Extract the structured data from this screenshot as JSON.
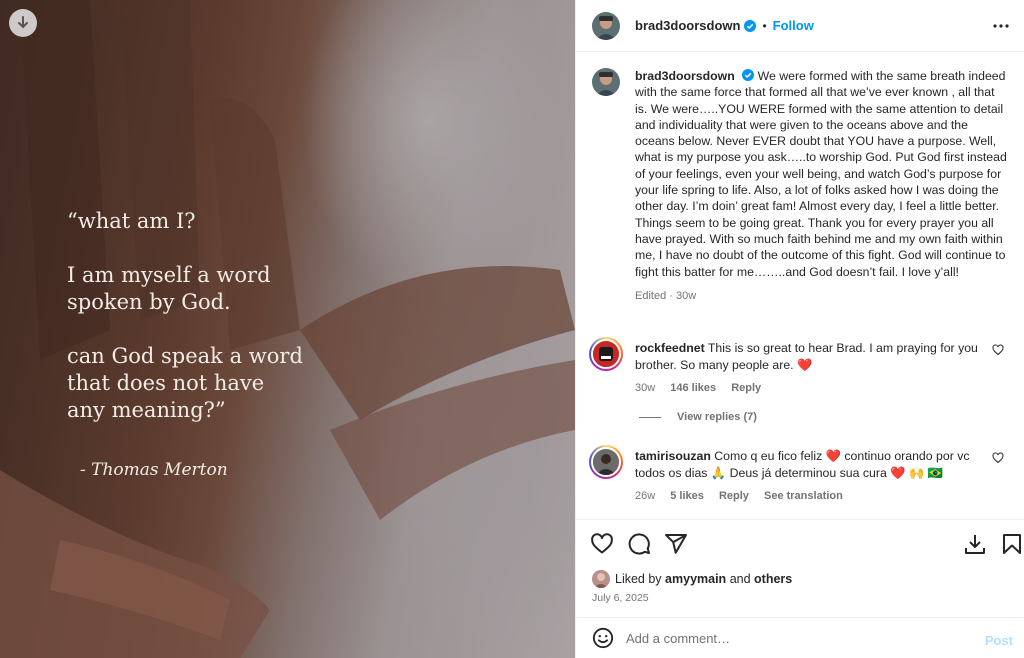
{
  "media": {
    "quote_lines": [
      "“what am I?",
      "I am myself a word\nspoken by God.",
      "can God speak a word\nthat does not have\nany meaning?”"
    ],
    "author": "- Thomas Merton",
    "download_icon": "download-arrow-icon"
  },
  "header": {
    "username": "brad3doorsdown",
    "dot": "•",
    "follow_label": "Follow",
    "verified_icon": "verified-badge-icon",
    "more_icon": "more-options-icon"
  },
  "caption": {
    "username": "brad3doorsdown",
    "text": "We were formed with the same breath indeed with the same force that formed all that we’ve ever known , all that is. We were…..YOU WERE formed with the same attention to detail and individuality that were given to the oceans above and the oceans below. Never EVER doubt that YOU have a purpose. Well, what is my purpose you ask…..to worship God. Put God first instead of your feelings, even your well being, and watch God’s purpose for your life spring to life. Also, a lot of folks asked how I was doing the other day. I’m doin’ great fam! Almost every day, I feel a little better. Things seem to be going great. Thank you for every prayer you all have prayed. With so much faith behind me and my own faith within me, I have no doubt of the outcome of this fight. God will continue to fight this batter for me……..and God doesn’t fail. I love y’all!",
    "meta": "Edited · 30w"
  },
  "comments": [
    {
      "username": "rockfeednet",
      "text": "This is so great to hear Brad. I am praying for you brother. So many people are. ❤️",
      "age": "30w",
      "likes": "146 likes",
      "reply": "Reply",
      "view_replies": "View replies (7)"
    },
    {
      "username": "tamirisouzan",
      "text": "Como q eu fico feliz ❤️ continuo orando por vc todos os dias 🙏 Deus já determinou sua cura ❤️ 🙌 🇧🇷",
      "age": "26w",
      "likes": "5 likes",
      "reply": "Reply",
      "translation": "See translation"
    }
  ],
  "actions": {
    "like_icon": "heart-icon",
    "comment_icon": "comment-icon",
    "share_icon": "share-icon",
    "download_icon": "download-icon",
    "save_icon": "bookmark-icon"
  },
  "likes": {
    "prefix": "Liked by",
    "user": "amyymain",
    "and": "and",
    "others": "others"
  },
  "date": "July 6, 2025",
  "add_comment": {
    "placeholder": "Add a comment…",
    "post_label": "Post",
    "emoji_icon": "emoji-icon"
  },
  "colors": {
    "accent": "#0095f6",
    "post_disabled": "#b2dffc",
    "heart_red": "#ed4956",
    "muted": "#737373"
  }
}
